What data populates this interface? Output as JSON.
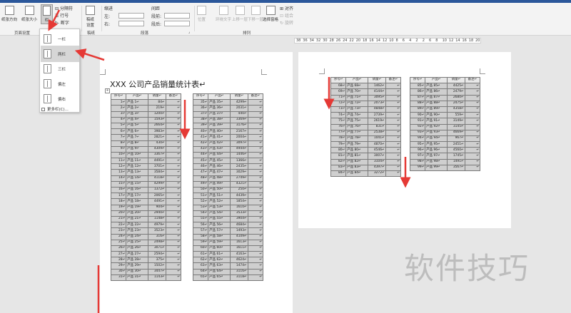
{
  "ribbon": {
    "buttons": {
      "orientation": "纸张方向",
      "size": "纸张大小",
      "columns": "栏",
      "breaks": "分隔符",
      "line_numbers": "行号",
      "hyphenation": "断字",
      "draft_settings": "稿纸\n设置",
      "position": "位置",
      "wrap_text": "环绕文字",
      "bring_forward": "上移一层",
      "send_backward": "下移一层",
      "selection_pane": "选择窗格",
      "align": "对齐",
      "group": "组合",
      "rotate": "旋转"
    },
    "indent": {
      "label": "缩进",
      "left": "左:",
      "right": "右:"
    },
    "spacing": {
      "label": "间距",
      "before": "段前:",
      "after": "段后:"
    },
    "groups": {
      "page_setup": "页面设置",
      "draft": "稿纸",
      "paragraph": "段落",
      "arrange": "排列"
    }
  },
  "columns_menu": {
    "items": [
      "一栏",
      "两栏",
      "三栏",
      "偏左",
      "偏右"
    ],
    "selected": "两栏",
    "more": "更多栏(C)..."
  },
  "ruler": {
    "numbers": [
      "38",
      "36",
      "34",
      "32",
      "30",
      "28",
      "26",
      "24",
      "22",
      "20",
      "18",
      "16",
      "14",
      "12",
      "10",
      "8",
      "6",
      "4",
      "2",
      "2",
      "6",
      "8",
      "10",
      "12",
      "14",
      "16",
      "18",
      "20"
    ]
  },
  "document": {
    "title": "XXX 公司产品销量统计表↵",
    "headers": [
      "序号↵",
      "产品↵",
      "销量↵",
      "备注↵"
    ],
    "col1": [
      [
        "1↵",
        "产品 1↵",
        "84↵",
        "↵"
      ],
      [
        "2↵",
        "产品 2↵",
        "219↵",
        "↵"
      ],
      [
        "3↵",
        "产品 3↵",
        "1200↵",
        "↵"
      ],
      [
        "4↵",
        "产品 4↵",
        "1593↵",
        "↵"
      ],
      [
        "5↵",
        "产品 5↵",
        "2664↵",
        "↵"
      ],
      [
        "6↵",
        "产品 6↵",
        "3983↵",
        "↵"
      ],
      [
        "7↵",
        "产品 7↵",
        "2821↵",
        "↵"
      ],
      [
        "8↵",
        "产品 8↵",
        "430↵",
        "↵"
      ],
      [
        "9↵",
        "产品 9↵",
        "4309↵",
        "↵"
      ],
      [
        "10↵",
        "产品 10↵",
        "3367↵",
        "↵"
      ],
      [
        "11↵",
        "产品 11↵",
        "4491↵",
        "↵"
      ],
      [
        "12↵",
        "产品 12↵",
        "3701↵",
        "↵"
      ],
      [
        "13↵",
        "产品 13↵",
        "3584↵",
        "↵"
      ],
      [
        "14↵",
        "产品 14↵",
        "4118↵",
        "↵"
      ],
      [
        "15↵",
        "产品 15↵",
        "4299↵",
        "↵"
      ],
      [
        "16↵",
        "产品 16↵",
        "1372↵",
        "↵"
      ],
      [
        "17↵",
        "产品 17↵",
        "2065↵",
        "↵"
      ],
      [
        "18↵",
        "产品 18↵",
        "4491↵",
        "↵"
      ],
      [
        "19↵",
        "产品 19↵",
        "904↵",
        "↵"
      ],
      [
        "20↵",
        "产品 20↵",
        "2940↵",
        "↵"
      ],
      [
        "21↵",
        "产品 21↵",
        "1148↵",
        "↵"
      ],
      [
        "22↵",
        "产品 22↵",
        "4979↵",
        "↵"
      ],
      [
        "23↵",
        "产品 23↵",
        "3523↵",
        "↵"
      ],
      [
        "24↵",
        "产品 24↵",
        "316↵",
        "↵"
      ],
      [
        "25↵",
        "产品 25↵",
        "2498↵",
        "↵"
      ],
      [
        "26↵",
        "产品 26↵",
        "3071↵",
        "↵"
      ],
      [
        "27↵",
        "产品 27↵",
        "2594↵",
        "↵"
      ],
      [
        "28↵",
        "产品 28↵",
        "375↵",
        "↵"
      ],
      [
        "29↵",
        "产品 29↵",
        "1502↵",
        "↵"
      ],
      [
        "30↵",
        "产品 30↵",
        "3447↵",
        "↵"
      ],
      [
        "31↵",
        "产品 31↵",
        "1143↵",
        "↵"
      ]
    ],
    "col2": [
      [
        "35↵",
        "产品 35↵",
        "4299↵",
        "↵"
      ],
      [
        "36↵",
        "产品 36↵",
        "2031↵",
        "↵"
      ],
      [
        "37↵",
        "产品 37↵",
        "440↵",
        "↵"
      ],
      [
        "38↵",
        "产品 38↵",
        "3369↵",
        "↵"
      ],
      [
        "39↵",
        "产品 39↵",
        "3176↵",
        "↵"
      ],
      [
        "40↵",
        "产品 40↵",
        "2167↵",
        "↵"
      ],
      [
        "41↵",
        "产品 41↵",
        "2004↵",
        "↵"
      ],
      [
        "42↵",
        "产品 42↵",
        "3097↵",
        "↵"
      ],
      [
        "43↵",
        "产品 43↵",
        "4944↵",
        "↵"
      ],
      [
        "44↵",
        "产品 44↵",
        "1446↵",
        "↵"
      ],
      [
        "45↵",
        "产品 45↵",
        "1366↵",
        "↵"
      ],
      [
        "46↵",
        "产品 46↵",
        "2435↵",
        "↵"
      ],
      [
        "47↵",
        "产品 47↵",
        "3029↵",
        "↵"
      ],
      [
        "48↵",
        "产品 48↵",
        "2749↵",
        "↵"
      ],
      [
        "49↵",
        "产品 49↵",
        "4321↵",
        "↵"
      ],
      [
        "50↵",
        "产品 50↵",
        "250↵",
        "↵"
      ],
      [
        "51↵",
        "产品 51↵",
        "4439↵",
        "↵"
      ],
      [
        "52↵",
        "产品 52↵",
        "1854↵",
        "↵"
      ],
      [
        "53↵",
        "产品 53↵",
        "1610↵",
        "↵"
      ],
      [
        "54↵",
        "产品 54↵",
        "3533↵",
        "↵"
      ],
      [
        "55↵",
        "产品 55↵",
        "3904↵",
        "↵"
      ],
      [
        "56↵",
        "产品 56↵",
        "4684↵",
        "↵"
      ],
      [
        "57↵",
        "产品 57↵",
        "1493↵",
        "↵"
      ],
      [
        "58↵",
        "产品 58↵",
        "4109↵",
        "↵"
      ],
      [
        "59↵",
        "产品 59↵",
        "1613↵",
        "↵"
      ],
      [
        "60↵",
        "产品 60↵",
        "1611↵",
        "↵"
      ],
      [
        "61↵",
        "产品 61↵",
        "4163↵",
        "↵"
      ],
      [
        "62↵",
        "产品 62↵",
        "4624↵",
        "↵"
      ],
      [
        "63↵",
        "产品 63↵",
        "1474↵",
        "↵"
      ],
      [
        "64↵",
        "产品 64↵",
        "3116↵",
        "↵"
      ],
      [
        "65↵",
        "产品 65↵",
        "3118↵",
        "↵"
      ]
    ],
    "col3": [
      [
        "68↵",
        "产品 68↵",
        "1462↵",
        "↵"
      ],
      [
        "69↵",
        "产品 70↵",
        "4144↵",
        "↵"
      ],
      [
        "71↵",
        "产品 71↵",
        "3095↵",
        "↵"
      ],
      [
        "72↵",
        "产品 72↵",
        "2073↵",
        "↵"
      ],
      [
        "73↵",
        "产品 73↵",
        "4848↵",
        "↵"
      ],
      [
        "74↵",
        "产品 74↵",
        "2739↵",
        "↵"
      ],
      [
        "75↵",
        "产品 75↵",
        "2619↵",
        "↵"
      ],
      [
        "76↵",
        "产品 76↵",
        "831↵",
        "↵"
      ],
      [
        "77↵",
        "产品 77↵",
        "2538↵",
        "↵"
      ],
      [
        "78↵",
        "产品 78↵",
        "1041↵",
        "↵"
      ],
      [
        "79↵",
        "产品 79↵",
        "4870↵",
        "↵"
      ],
      [
        "80↵",
        "产品 80↵",
        "4546↵",
        "↵"
      ],
      [
        "81↵",
        "产品 81↵",
        "3007↵",
        "↵"
      ],
      [
        "82↵",
        "产品 82↵",
        "3104↵",
        "↵"
      ],
      [
        "83↵",
        "产品 83↵",
        "4397↵",
        "↵"
      ],
      [
        "84↵",
        "产品 84↵",
        "3272↵",
        "↵"
      ]
    ],
    "col4": [
      [
        "85↵",
        "产品 85↵",
        "4425↵",
        "↵"
      ],
      [
        "86↵",
        "产品 86↵",
        "2479↵",
        "↵"
      ],
      [
        "87↵",
        "产品 87↵",
        "2680↵",
        "↵"
      ],
      [
        "88↵",
        "产品 88↵",
        "2475↵",
        "↵"
      ],
      [
        "89↵",
        "产品 89↵",
        "4358↵",
        "↵"
      ],
      [
        "90↵",
        "产品 90↵",
        "559↵",
        "↵"
      ],
      [
        "91↵",
        "产品 91↵",
        "3149↵",
        "↵"
      ],
      [
        "92↵",
        "产品 92↵",
        "3145↵",
        "↵"
      ],
      [
        "93↵",
        "产品 93↵",
        "4669↵",
        "↵"
      ],
      [
        "94↵",
        "产品 94↵",
        "967↵",
        "↵"
      ],
      [
        "95↵",
        "产品 95↵",
        "2451↵",
        "↵"
      ],
      [
        "96↵",
        "产品 96↵",
        "4560↵",
        "↵"
      ],
      [
        "97↵",
        "产品 97↵",
        "1745↵",
        "↵"
      ],
      [
        "98↵",
        "产品 98↵",
        "1491↵",
        "↵"
      ],
      [
        "99↵",
        "产品 99↵",
        "3567↵",
        "↵"
      ]
    ]
  },
  "watermark": "软件技巧",
  "colors": {
    "accent": "#2b579a",
    "arrow": "#e53935",
    "table_fill": "#cfcfcf"
  }
}
